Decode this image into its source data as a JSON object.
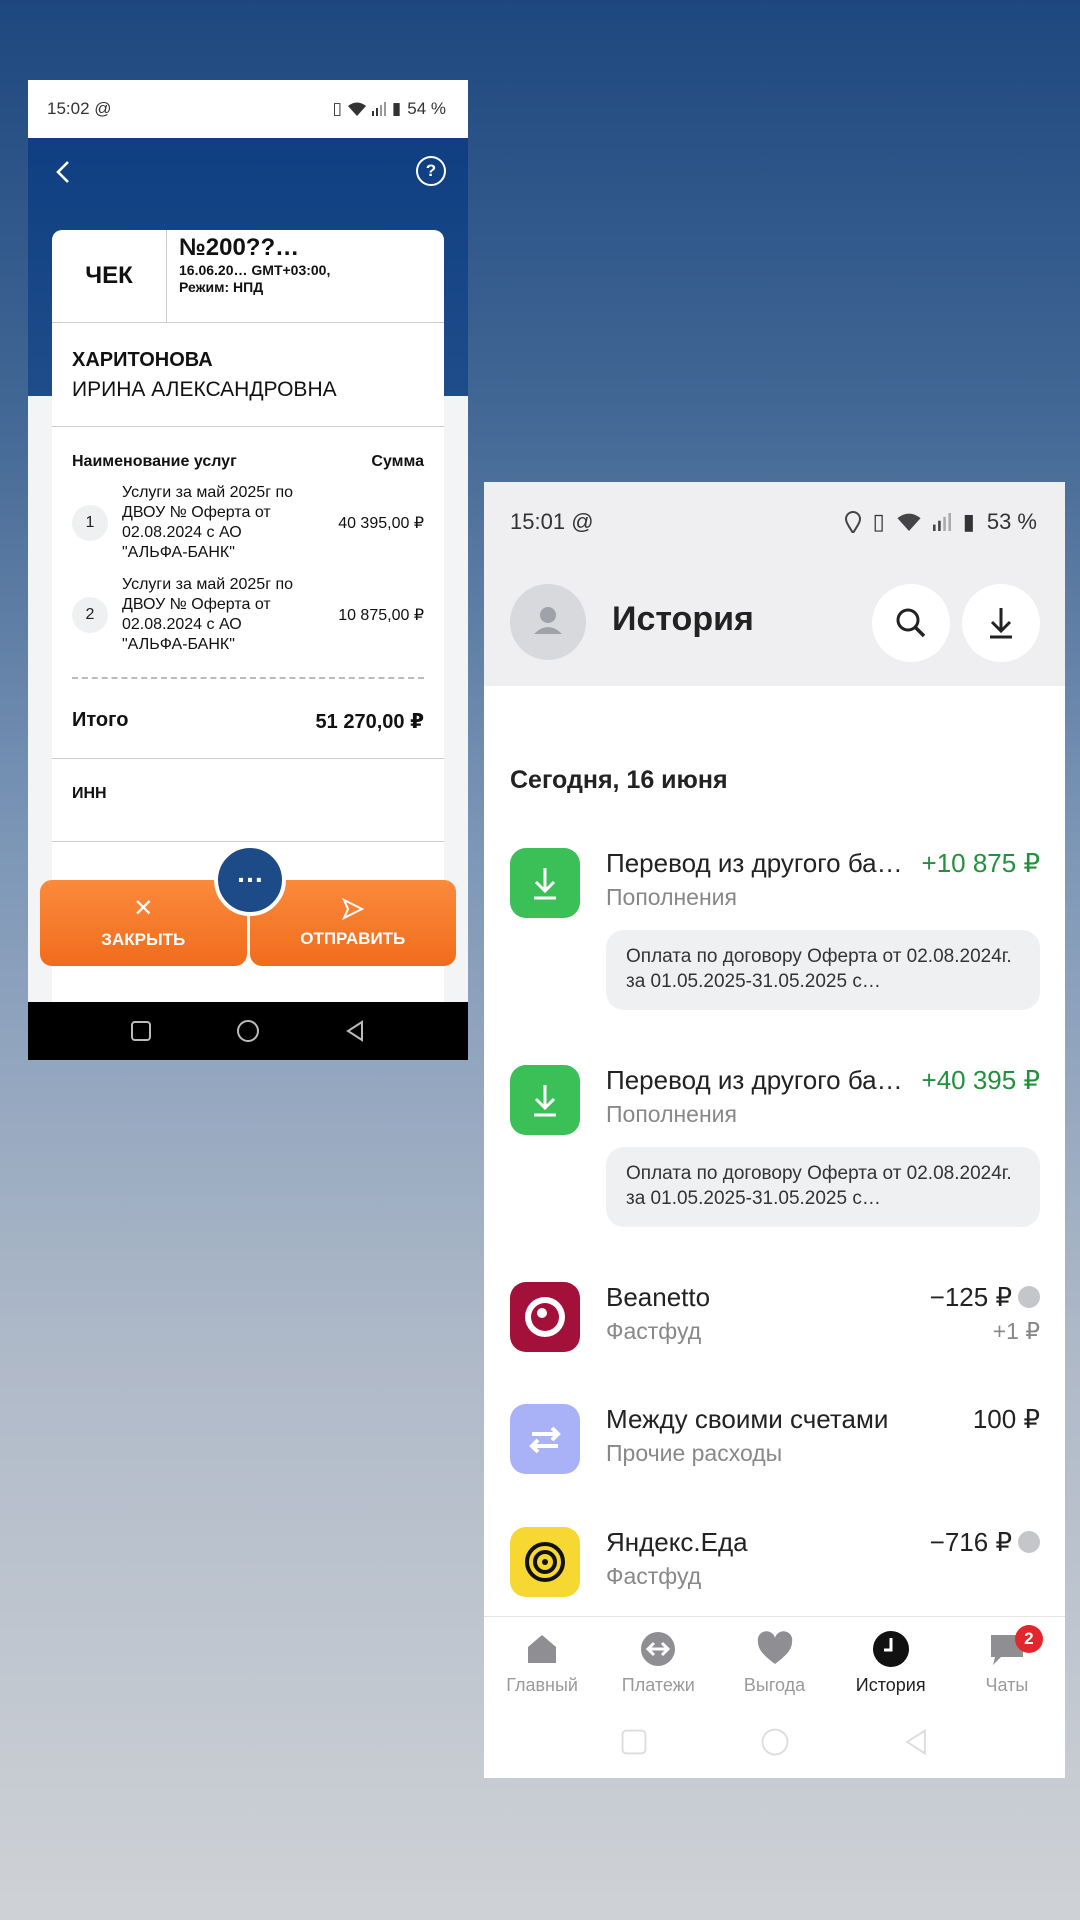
{
  "left_phone": {
    "status_bar": {
      "time": "15:02",
      "at": "@",
      "battery": "54 %"
    },
    "receipt": {
      "title": "ЧЕК",
      "number": "№200??…",
      "datetime": "16.06.20…   GMT+03:00,",
      "mode": "Режим: НПД",
      "surname": "ХАРИТОНОВА",
      "given_names": "ИРИНА АЛЕКСАНДРОВНА",
      "table_header": {
        "service": "Наименование услуг",
        "sum": "Сумма"
      },
      "items": [
        {
          "index": "1",
          "description": "Услуги за май 2025г по ДВОУ № Оферта от 02.08.2024 с АО \"АЛЬФА-БАНК\"",
          "amount": "40 395,00 ₽"
        },
        {
          "index": "2",
          "description": "Услуги за май 2025г по ДВОУ № Оферта от 02.08.2024 с АО \"АЛЬФА-БАНК\"",
          "amount": "10 875,00 ₽"
        }
      ],
      "total_label": "Итого",
      "total_value": "51 270,00 ₽",
      "inn_label": "ИНН"
    },
    "actions": {
      "close": "ЗАКРЫТЬ",
      "send": "ОТПРАВИТЬ",
      "more": "…"
    }
  },
  "right_phone": {
    "status_bar": {
      "time": "15:01",
      "at": "@",
      "battery": "53 %"
    },
    "header": {
      "title": "История"
    },
    "section_date": "Сегодня, 16 июня",
    "transactions": [
      {
        "title": "Перевод из другого ба…",
        "category": "Пополнения",
        "amount": "+10 875 ₽",
        "note": "Оплата по договору Оферта от 02.08.2024г. за 01.05.2025-31.05.2025 с…",
        "icon": "download-icon",
        "color": "#3bbf57"
      },
      {
        "title": "Перевод из другого ба…",
        "category": "Пополнения",
        "amount": "+40 395 ₽",
        "note": "Оплата по договору Оферта от 02.08.2024г. за 01.05.2025-31.05.2025 с…",
        "icon": "download-icon",
        "color": "#3bbf57"
      },
      {
        "title": "Beanetto",
        "category": "Фастфуд",
        "amount": "−125 ₽",
        "cashback": "+1 ₽",
        "icon": "beanetto-logo",
        "color": "#a3113a"
      },
      {
        "title": "Между своими счетами",
        "category": "Прочие расходы",
        "amount": "100 ₽",
        "icon": "transfer-arrows-icon",
        "color": "#a9b1f7"
      },
      {
        "title": "Яндекс.Еда",
        "category": "Фастфуд",
        "amount": "−716 ₽",
        "icon": "yandex-eda-logo",
        "color": "#f7d731"
      }
    ],
    "tabs": [
      {
        "label": "Главный",
        "icon": "home-icon"
      },
      {
        "label": "Платежи",
        "icon": "payments-icon"
      },
      {
        "label": "Выгода",
        "icon": "heart-icon"
      },
      {
        "label": "История",
        "icon": "clock-icon",
        "active": true
      },
      {
        "label": "Чаты",
        "icon": "chat-icon",
        "badge": "2"
      }
    ],
    "accent_green": "#22913d"
  }
}
